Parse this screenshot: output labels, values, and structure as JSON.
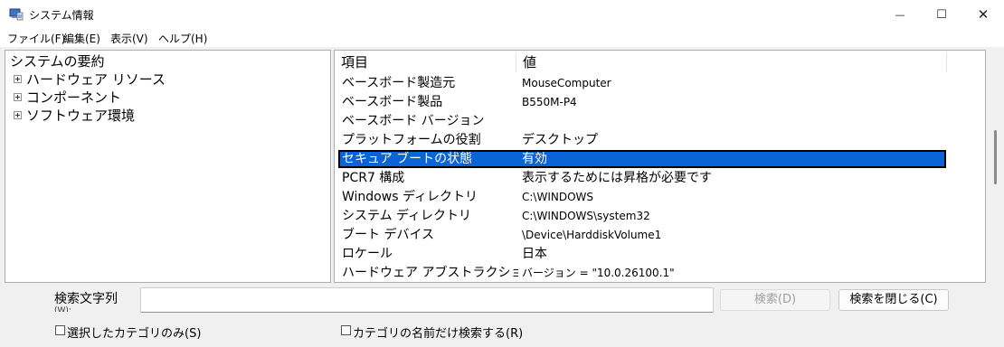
{
  "window": {
    "title": "システム情報",
    "minimize_glyph": "—",
    "maximize_glyph": "☐",
    "close_glyph": "✕"
  },
  "menu": {
    "items": [
      "ファイル(F)",
      "編集(E)",
      "表示(V)",
      "ヘルプ(H)"
    ]
  },
  "tree": {
    "root": "システムの要約",
    "children": [
      "ハードウェア リソース",
      "コンポーネント",
      "ソフトウェア環境"
    ]
  },
  "details": {
    "headers": {
      "item": "項目",
      "value": "値"
    },
    "rows": [
      {
        "item": "ベースボード製造元",
        "value": "MouseComputer"
      },
      {
        "item": "ベースボード製品",
        "value": "B550M-P4"
      },
      {
        "item": "ベースボード バージョン",
        "value": ""
      },
      {
        "item": "プラットフォームの役割",
        "value": "デスクトップ"
      },
      {
        "item": "セキュア ブートの状態",
        "value": "有効"
      },
      {
        "item": "PCR7 構成",
        "value": "表示するためには昇格が必要です"
      },
      {
        "item": "Windows ディレクトリ",
        "value": "C:\\WINDOWS"
      },
      {
        "item": "システム ディレクトリ",
        "value": "C:\\WINDOWS\\system32"
      },
      {
        "item": "ブート デバイス",
        "value": "\\Device\\HarddiskVolume1"
      },
      {
        "item": "ロケール",
        "value": "日本"
      },
      {
        "item": "ハードウェア アブストラクション ...",
        "value": "バージョン = \"10.0.26100.1\""
      }
    ],
    "selected_row": 4
  },
  "search": {
    "label": "検索文字列",
    "label_extra": "(W):",
    "input_value": "",
    "search_button": "検索(D)",
    "close_button": "検索を閉じる(C)",
    "checkbox_selected_only": "選択したカテゴリのみ(S)",
    "checkbox_names_only": "カテゴリの名前だけ検索する(R)"
  },
  "colors": {
    "selection": "#0a64d8",
    "background": "#f0f0f0"
  }
}
